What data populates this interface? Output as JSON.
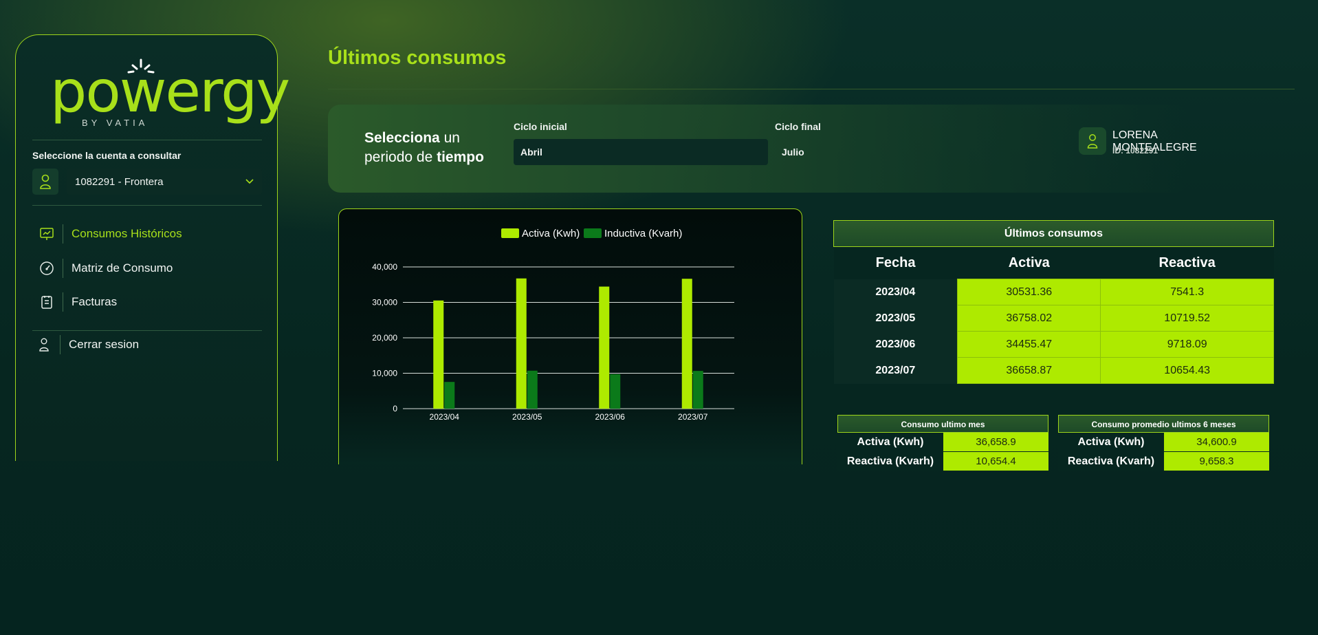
{
  "brand": {
    "name": "powergy",
    "tagline": "BY VATIA",
    "accent": "#a8e01a"
  },
  "sidebar": {
    "account_label": "Seleccione la cuenta a consultar",
    "account_value": "1082291 - Frontera",
    "nav": [
      {
        "label": "Consumos Históricos",
        "icon": "chart-presentation-icon",
        "active": true
      },
      {
        "label": "Matriz de Consumo",
        "icon": "gauge-icon",
        "active": false
      },
      {
        "label": "Facturas",
        "icon": "invoice-icon",
        "active": false
      }
    ],
    "logout_label": "Cerrar sesion"
  },
  "header": {
    "title": "Últimos consumos"
  },
  "period": {
    "prompt_bold1": "Selecciona",
    "prompt_rest1": " un",
    "prompt_rest2": "periodo de ",
    "prompt_bold2": "tiempo",
    "start_label": "Ciclo inicial",
    "start_value": "Abril",
    "end_label": "Ciclo final",
    "end_value": "Julio"
  },
  "user": {
    "name": "LORENA MONTEALEGRE",
    "id": "ID: 1082291"
  },
  "chart_data": {
    "type": "bar",
    "categories": [
      "2023/04",
      "2023/05",
      "2023/06",
      "2023/07"
    ],
    "series": [
      {
        "name": "Activa (Kwh)",
        "color": "#aeea00",
        "values": [
          30531.36,
          36758.02,
          34455.47,
          36658.87
        ]
      },
      {
        "name": "Inductiva (Kvarh)",
        "color": "#0b7a1a",
        "values": [
          7541.3,
          10719.52,
          9718.09,
          10654.43
        ]
      }
    ],
    "y_ticks": [
      "0",
      "10,000",
      "20,000",
      "30,000",
      "40,000"
    ],
    "ylim": [
      0,
      40000
    ],
    "grid": true,
    "legend": "top"
  },
  "table": {
    "title": "Últimos consumos",
    "columns": [
      "Fecha",
      "Activa",
      "Reactiva"
    ],
    "rows": [
      [
        "2023/04",
        "30531.36",
        "7541.3"
      ],
      [
        "2023/05",
        "36758.02",
        "10719.52"
      ],
      [
        "2023/06",
        "34455.47",
        "9718.09"
      ],
      [
        "2023/07",
        "36658.87",
        "10654.43"
      ]
    ]
  },
  "summary_last": {
    "title": "Consumo ultimo mes",
    "rows": [
      {
        "label": "Activa (Kwh)",
        "value": "36,658.9"
      },
      {
        "label": "Reactiva (Kvarh)",
        "value": "10,654.4"
      }
    ]
  },
  "summary_avg": {
    "title": "Consumo promedio ultimos 6 meses",
    "rows": [
      {
        "label": "Activa (Kwh)",
        "value": "34,600.9"
      },
      {
        "label": "Reactiva (Kvarh)",
        "value": "9,658.3"
      }
    ]
  }
}
